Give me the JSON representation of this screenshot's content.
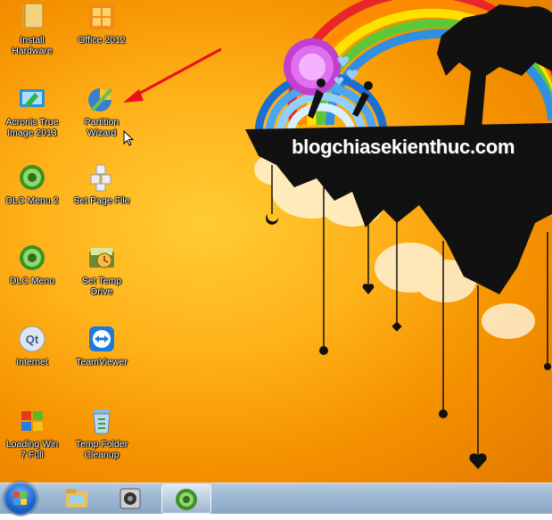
{
  "desktop": {
    "watermark": "blogchiasekienthuc.com",
    "icons": [
      {
        "label": "Install\nHardware",
        "icon": "folder-icon"
      },
      {
        "label": "Office 2012",
        "icon": "office-icon"
      },
      {
        "label": "Acronis True\nImage 2013",
        "icon": "acronis-icon"
      },
      {
        "label": "Partition\nWizard",
        "icon": "partition-wizard-icon"
      },
      {
        "label": "DLC Menu 2",
        "icon": "dlc-icon"
      },
      {
        "label": "Set Page File",
        "icon": "page-file-icon"
      },
      {
        "label": "DLC Menu",
        "icon": "dlc-icon"
      },
      {
        "label": "Set Temp\nDrive",
        "icon": "temp-drive-icon"
      },
      {
        "label": "Internet",
        "icon": "quicktime-icon"
      },
      {
        "label": "TeamViewer",
        "icon": "teamviewer-icon"
      },
      {
        "label": "Loading Win\n7 Full",
        "icon": "windows-flag-icon"
      },
      {
        "label": "Temp Folder\nCleanup",
        "icon": "recycle-bin-icon"
      }
    ]
  },
  "taskbar": {
    "start": "start-orb-icon",
    "items": [
      "explorer-icon",
      "webcam-icon",
      "dlc-icon"
    ]
  },
  "colors": {
    "arrow": "#e8101a",
    "taskbar": "#9fb9d4",
    "background": "#f5a300"
  }
}
